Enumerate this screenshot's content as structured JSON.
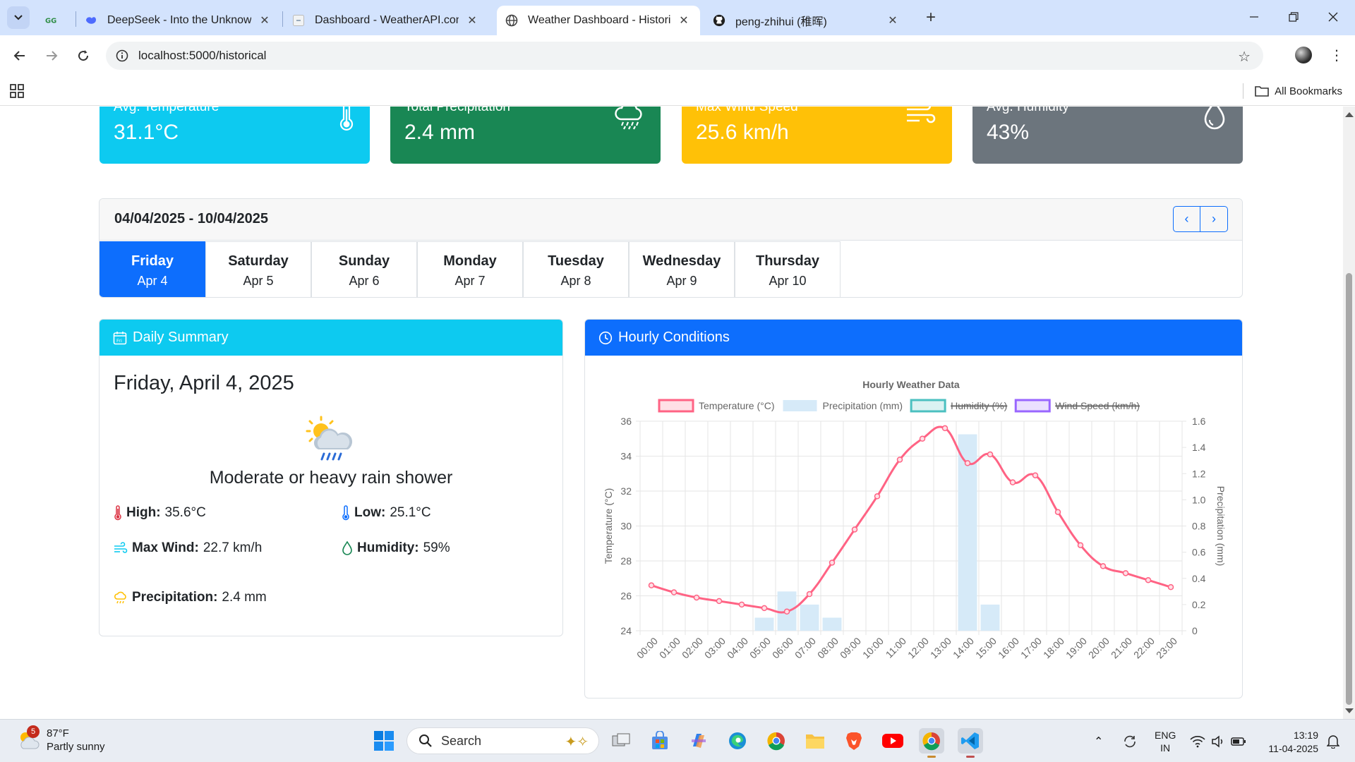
{
  "browser": {
    "tabs": [
      {
        "label": "",
        "icon": "geeksforgeeks-icon"
      },
      {
        "label": "DeepSeek - Into the Unknown",
        "icon": "deepseek-icon"
      },
      {
        "label": "Dashboard - WeatherAPI.com",
        "icon": "weatherapi-icon"
      },
      {
        "label": "Weather Dashboard - Historical",
        "icon": "globe-icon",
        "active": true
      },
      {
        "label": "peng-zhihui (稚晖)",
        "icon": "github-icon"
      }
    ],
    "url": "localhost:5000/historical",
    "bookmarks_label": "All Bookmarks"
  },
  "stats": [
    {
      "label": "Avg. Temperature",
      "value": "31.1°C",
      "color": "#0dcaf0",
      "icon": "thermometer-icon"
    },
    {
      "label": "Total Precipitation",
      "value": "2.4 mm",
      "color": "#198754",
      "icon": "cloud-rain-icon"
    },
    {
      "label": "Max Wind Speed",
      "value": "25.6 km/h",
      "color": "#ffc107",
      "icon": "wind-icon"
    },
    {
      "label": "Avg. Humidity",
      "value": "43%",
      "color": "#6c757d",
      "icon": "droplet-icon"
    }
  ],
  "week": {
    "range": "04/04/2025 - 10/04/2025",
    "days": [
      {
        "name": "Friday",
        "date": "Apr 4",
        "active": true
      },
      {
        "name": "Saturday",
        "date": "Apr 5"
      },
      {
        "name": "Sunday",
        "date": "Apr 6"
      },
      {
        "name": "Monday",
        "date": "Apr 7"
      },
      {
        "name": "Tuesday",
        "date": "Apr 8"
      },
      {
        "name": "Wednesday",
        "date": "Apr 9"
      },
      {
        "name": "Thursday",
        "date": "Apr 10"
      }
    ]
  },
  "summary": {
    "header": "Daily Summary",
    "date": "Friday, April 4, 2025",
    "condition": "Moderate or heavy rain shower",
    "high_label": "High:",
    "high": "35.6°C",
    "low_label": "Low:",
    "low": "25.1°C",
    "wind_label": "Max Wind:",
    "wind": "22.7 km/h",
    "humidity_label": "Humidity:",
    "humidity": "59%",
    "precip_label": "Precipitation:",
    "precip": "2.4 mm"
  },
  "hourly": {
    "header": "Hourly Conditions"
  },
  "chart_data": {
    "type": "line",
    "title": "Hourly Weather Data",
    "x": [
      "00:00",
      "01:00",
      "02:00",
      "03:00",
      "04:00",
      "05:00",
      "06:00",
      "07:00",
      "08:00",
      "09:00",
      "10:00",
      "11:00",
      "12:00",
      "13:00",
      "14:00",
      "15:00",
      "16:00",
      "17:00",
      "18:00",
      "19:00",
      "20:00",
      "21:00",
      "22:00",
      "23:00"
    ],
    "series": [
      {
        "name": "Temperature (°C)",
        "type": "line",
        "axis": "left",
        "color": "#ff6384",
        "values": [
          26.6,
          26.2,
          25.9,
          25.7,
          25.5,
          25.3,
          25.1,
          26.1,
          27.9,
          29.8,
          31.7,
          33.8,
          35.0,
          35.6,
          33.6,
          34.1,
          32.5,
          32.9,
          30.8,
          28.9,
          27.7,
          27.3,
          26.9,
          26.5
        ]
      },
      {
        "name": "Precipitation (mm)",
        "type": "bar",
        "axis": "right",
        "color": "#d6eaf8",
        "values": [
          0,
          0,
          0,
          0,
          0,
          0.1,
          0.3,
          0.2,
          0.1,
          0,
          0,
          0,
          0,
          0,
          1.5,
          0.2,
          0,
          0,
          0,
          0,
          0,
          0,
          0,
          0
        ]
      },
      {
        "name": "Humidity (%)",
        "hidden": true,
        "color": "#4bc0c0"
      },
      {
        "name": "Wind Speed (km/h)",
        "hidden": true,
        "color": "#9966ff"
      }
    ],
    "ylabel": "Temperature (°C)",
    "ylim": [
      24,
      36
    ],
    "yticks": [
      24,
      26,
      28,
      30,
      32,
      34,
      36
    ],
    "y2label": "Precipitation (mm)",
    "y2lim": [
      0,
      1.6
    ],
    "y2ticks": [
      "0",
      "0.2",
      "0.4",
      "0.6",
      "0.8",
      "1.0",
      "1.2",
      "1.4",
      "1.6"
    ],
    "grid": true,
    "legend": "top"
  },
  "taskbar": {
    "weather_temp": "87°F",
    "weather_desc": "Partly sunny",
    "weather_badge": "5",
    "search_label": "Search",
    "lang_top": "ENG",
    "lang_bottom": "IN",
    "time": "13:19",
    "date": "11-04-2025"
  }
}
